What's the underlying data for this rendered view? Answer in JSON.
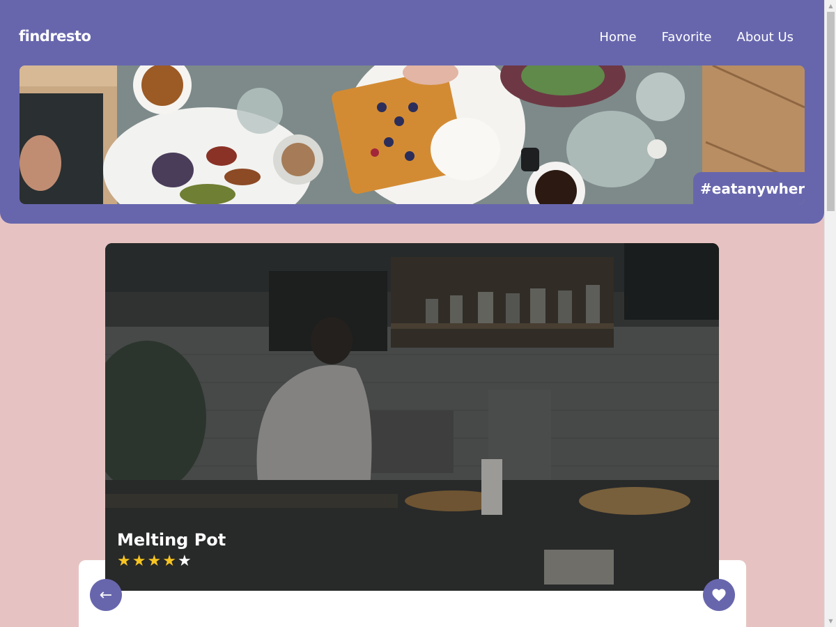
{
  "brand": "findresto",
  "nav": [
    {
      "label": "Home"
    },
    {
      "label": "Favorite"
    },
    {
      "label": "About Us"
    }
  ],
  "hero": {
    "hashtag": "#eatanywhere"
  },
  "restaurant": {
    "name": "Melting Pot",
    "rating": 4,
    "rating_max": 5
  },
  "icons": {
    "back": "arrow-left-icon",
    "favorite": "heart-icon"
  },
  "colors": {
    "primary": "#6766ad",
    "background": "#e6c3c2",
    "star": "#f7c521"
  }
}
